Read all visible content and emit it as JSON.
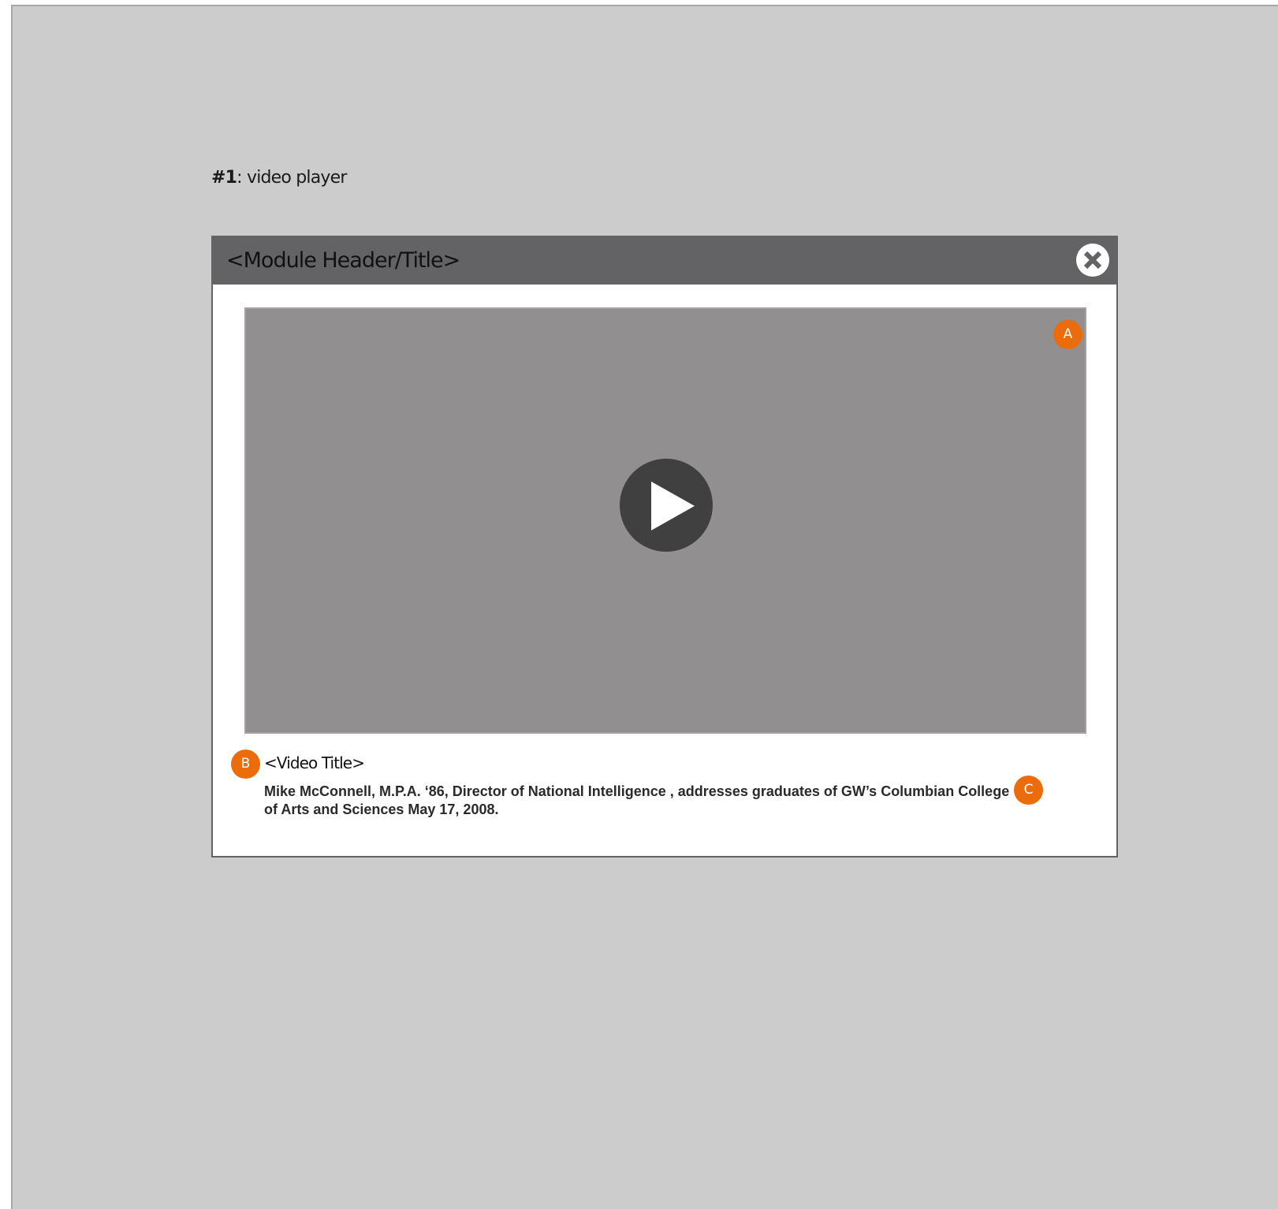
{
  "section": {
    "number": "#1",
    "separator": ":",
    "label": "video player"
  },
  "module": {
    "header_title": "<Module Header/Title>",
    "close_icon": "close-circle-icon"
  },
  "video": {
    "play_icon": "play-icon",
    "title": "<Video Title>",
    "description": "Mike McConnell, M.P.A. ‘86, Director of National Intelligence , addresses graduates of GW’s Columbian College of Arts and Sciences May 17, 2008."
  },
  "annotations": {
    "a": "A",
    "b": "B",
    "c": "C"
  },
  "colors": {
    "background": "#cccccc",
    "header": "#636365",
    "video_placeholder": "#918f90",
    "play_button": "#404040",
    "marker": "#ea6c0b"
  }
}
